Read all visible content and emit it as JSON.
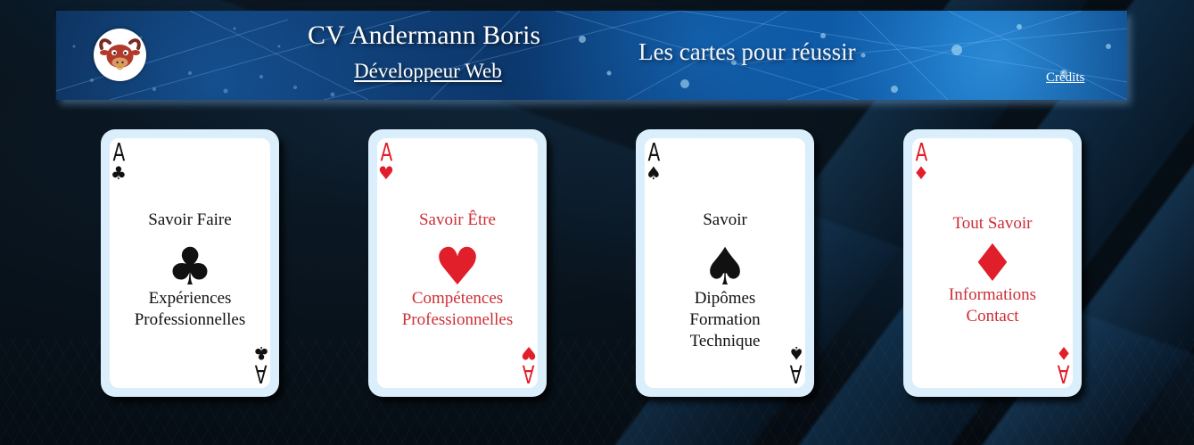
{
  "header": {
    "title": "CV Andermann Boris",
    "subtitle": "Développeur Web",
    "tagline": "Les cartes pour réussir",
    "credits": "Crédits",
    "logo": "bull-mascot-logo"
  },
  "cards": [
    {
      "rank": "A",
      "suit": "♣",
      "suit_name": "club-icon",
      "color": "black",
      "title": "Savoir Faire",
      "lines": [
        "Expériences",
        "Professionnelles"
      ]
    },
    {
      "rank": "A",
      "suit": "♥",
      "suit_name": "heart-icon",
      "color": "red",
      "title": "Savoir Être",
      "lines": [
        "Compétences",
        "Professionnelles"
      ]
    },
    {
      "rank": "A",
      "suit": "♠",
      "suit_name": "spade-icon",
      "color": "black",
      "title": "Savoir",
      "lines": [
        "Dipômes",
        "Formation",
        "Technique"
      ]
    },
    {
      "rank": "A",
      "suit": "♦",
      "suit_name": "diamond-icon",
      "color": "red",
      "title": "Tout Savoir",
      "lines": [
        "Informations",
        "Contact"
      ]
    }
  ],
  "colors": {
    "red_suit": "#e11f2b",
    "red_text": "#cd2e36",
    "black": "#111111",
    "card_border": "#dbeefb",
    "banner_blue": "#0a5aa8"
  }
}
